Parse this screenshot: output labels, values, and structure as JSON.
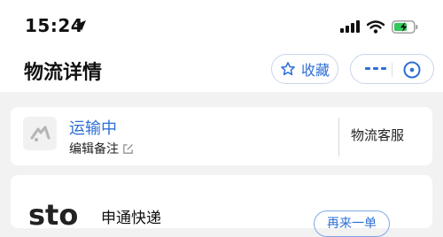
{
  "status_bar": {
    "time": "15:24"
  },
  "header": {
    "title": "物流详情",
    "favorite_label": "收藏"
  },
  "shipment": {
    "status": "运输中",
    "note_label": "编辑备注",
    "service_label": "物流客服"
  },
  "courier": {
    "name": "申通快递",
    "logo_text": "sto",
    "action_label": "再来一单"
  },
  "colors": {
    "accent": "#2d6fd6",
    "battery": "#34c759"
  }
}
